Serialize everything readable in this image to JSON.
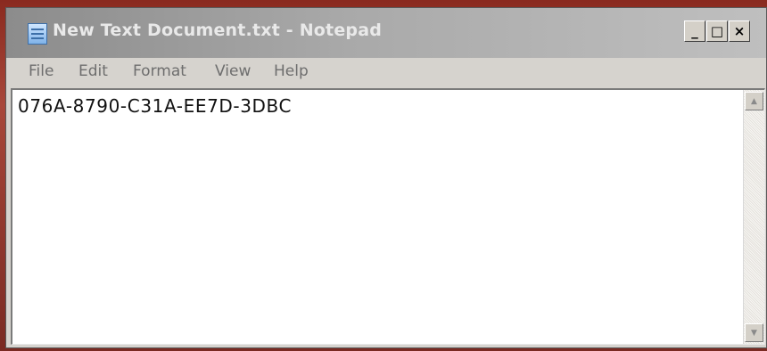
{
  "window": {
    "title": "New Text Document.txt - Notepad",
    "controls": {
      "minimize": "_",
      "maximize": "□",
      "close": "×"
    }
  },
  "menu": {
    "items": [
      {
        "label": "File"
      },
      {
        "label": "Edit"
      },
      {
        "label": "Format"
      },
      {
        "label": "View"
      },
      {
        "label": "Help"
      }
    ]
  },
  "editor": {
    "content": "076A-8790-C31A-EE7D-3DBC"
  },
  "icons": {
    "app": "notepad-icon",
    "scroll_up": "arrow-up-icon",
    "scroll_down": "arrow-down-icon"
  }
}
